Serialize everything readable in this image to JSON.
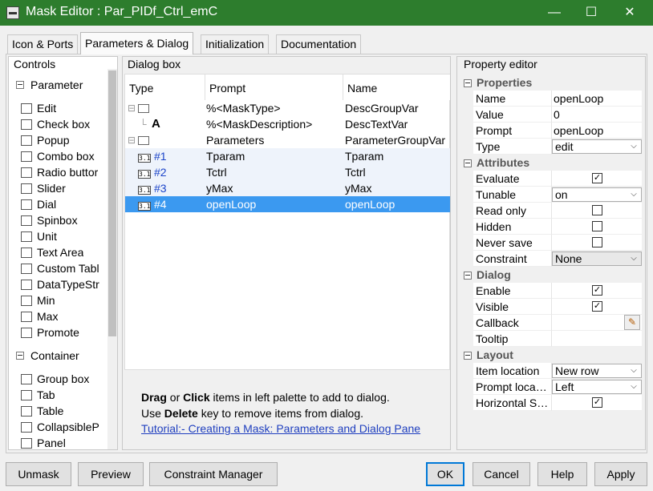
{
  "window": {
    "title": "Mask Editor : Par_PIDf_Ctrl_emC",
    "minimize": "—",
    "maximize": "☐",
    "close": "✕"
  },
  "tabs": [
    {
      "label": "Icon & Ports"
    },
    {
      "label": "Parameters & Dialog"
    },
    {
      "label": "Initialization"
    },
    {
      "label": "Documentation"
    }
  ],
  "controls": {
    "title": "Controls",
    "parameter_section": "Parameter",
    "parameter_items": [
      {
        "label": "Edit",
        "icon": "edit-icon"
      },
      {
        "label": "Check box",
        "icon": "checkbox-icon"
      },
      {
        "label": "Popup",
        "icon": "popup-icon"
      },
      {
        "label": "Combo box",
        "icon": "combobox-icon"
      },
      {
        "label": "Radio buttor",
        "icon": "radio-icon"
      },
      {
        "label": "Slider",
        "icon": "slider-icon"
      },
      {
        "label": "Dial",
        "icon": "dial-icon"
      },
      {
        "label": "Spinbox",
        "icon": "spinbox-icon"
      },
      {
        "label": "Unit",
        "icon": "unit-icon"
      },
      {
        "label": "Text Area",
        "icon": "textarea-icon"
      },
      {
        "label": "Custom Tabl",
        "icon": "table-icon"
      },
      {
        "label": "DataTypeStr",
        "icon": "datatype-icon"
      },
      {
        "label": "Min",
        "icon": "min-icon"
      },
      {
        "label": "Max",
        "icon": "max-icon"
      },
      {
        "label": "Promote",
        "icon": "promote-icon"
      }
    ],
    "container_section": "Container",
    "container_items": [
      {
        "label": "Group box",
        "icon": "groupbox-icon"
      },
      {
        "label": "Tab",
        "icon": "tab-icon"
      },
      {
        "label": "Table",
        "icon": "table-icon"
      },
      {
        "label": "CollapsibleP",
        "icon": "collapsible-icon"
      },
      {
        "label": "Panel",
        "icon": "panel-icon"
      }
    ]
  },
  "dialog_box": {
    "title": "Dialog box",
    "columns": [
      "Type",
      "Prompt",
      "Name"
    ],
    "rows": [
      {
        "type": "",
        "prompt": "%<MaskType>",
        "name": "DescGroupVar"
      },
      {
        "type": "A",
        "prompt": "%<MaskDescription>",
        "name": "DescTextVar"
      },
      {
        "type": "",
        "prompt": "Parameters",
        "name": "ParameterGroupVar"
      },
      {
        "type": "#1",
        "prompt": "Tparam",
        "name": "Tparam"
      },
      {
        "type": "#2",
        "prompt": "Tctrl",
        "name": "Tctrl"
      },
      {
        "type": "#3",
        "prompt": "yMax",
        "name": "yMax"
      },
      {
        "type": "#4",
        "prompt": "openLoop",
        "name": "openLoop"
      }
    ],
    "help_line1_a": "Drag",
    "help_line1_b": " or ",
    "help_line1_c": "Click",
    "help_line1_d": " items in left palette to add to dialog.",
    "help_line2_a": "Use ",
    "help_line2_b": "Delete",
    "help_line2_c": " key to remove items from dialog.",
    "tutorial_link": "Tutorial:- Creating a Mask: Parameters and Dialog Pane"
  },
  "property_editor": {
    "title": "Property editor",
    "properties_head": "Properties",
    "name_label": "Name",
    "name_value": "openLoop",
    "value_label": "Value",
    "value_value": "0",
    "prompt_label": "Prompt",
    "prompt_value": "openLoop",
    "type_label": "Type",
    "type_value": "edit",
    "attributes_head": "Attributes",
    "evaluate_label": "Evaluate",
    "tunable_label": "Tunable",
    "tunable_value": "on",
    "readonly_label": "Read only",
    "hidden_label": "Hidden",
    "neversave_label": "Never save",
    "constraint_label": "Constraint",
    "constraint_value": "None",
    "dialog_head": "Dialog",
    "enable_label": "Enable",
    "visible_label": "Visible",
    "callback_label": "Callback",
    "tooltip_label": "Tooltip",
    "layout_head": "Layout",
    "itemloc_label": "Item location",
    "itemloc_value": "New row",
    "promptloc_label": "Prompt loca…",
    "promptloc_value": "Left",
    "hstretch_label": "Horizontal S…",
    "check_mark": "✓"
  },
  "buttons": {
    "unmask": "Unmask",
    "preview": "Preview",
    "constraint_manager": "Constraint Manager",
    "ok": "OK",
    "cancel": "Cancel",
    "help": "Help",
    "apply": "Apply"
  },
  "colors": {
    "titlebar": "#2d7d2d",
    "selection": "#3b99f0",
    "link": "#1f3fbf"
  }
}
